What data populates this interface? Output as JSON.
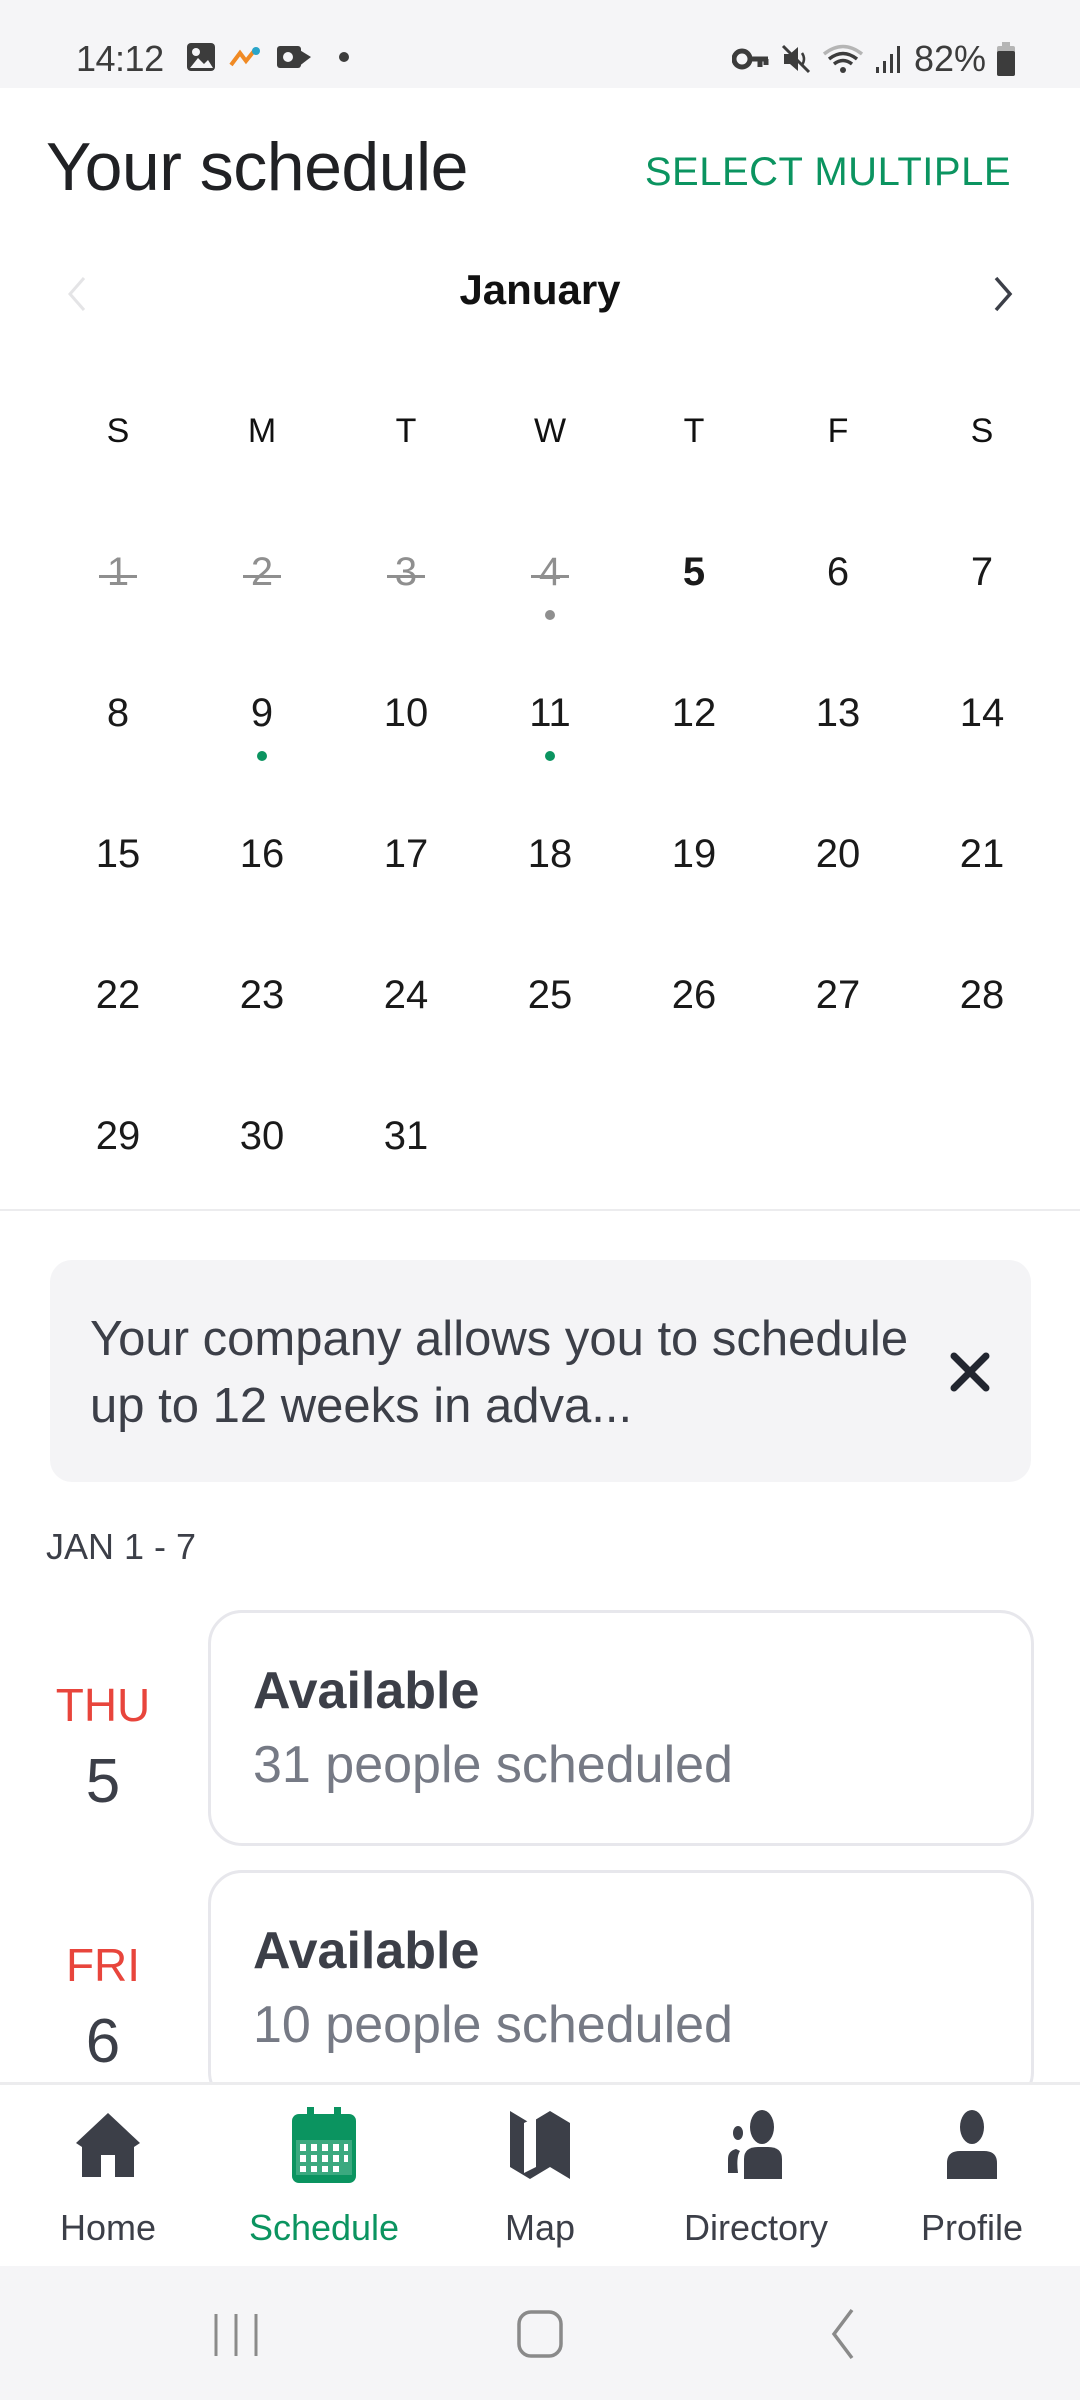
{
  "status_bar": {
    "time": "14:12",
    "battery": "82%",
    "left_icons": [
      "gallery-icon",
      "app-notification-icon",
      "outlook-icon",
      "more-dot-icon"
    ],
    "right_icons": [
      "vpn-key-icon",
      "mute-icon",
      "wifi-icon",
      "signal-icon",
      "battery-icon"
    ]
  },
  "header": {
    "title": "Your schedule",
    "select_multiple": "SELECT MULTIPLE"
  },
  "calendar": {
    "month": "January",
    "weekdays": [
      "S",
      "M",
      "T",
      "W",
      "T",
      "F",
      "S"
    ],
    "leading_blanks": 0,
    "days": [
      {
        "n": "1",
        "state": "past"
      },
      {
        "n": "2",
        "state": "past"
      },
      {
        "n": "3",
        "state": "past"
      },
      {
        "n": "4",
        "state": "past",
        "dot": "gray"
      },
      {
        "n": "5",
        "state": "today"
      },
      {
        "n": "6"
      },
      {
        "n": "7"
      },
      {
        "n": "8"
      },
      {
        "n": "9",
        "dot": "green"
      },
      {
        "n": "10"
      },
      {
        "n": "11",
        "dot": "green"
      },
      {
        "n": "12"
      },
      {
        "n": "13"
      },
      {
        "n": "14"
      },
      {
        "n": "15"
      },
      {
        "n": "16"
      },
      {
        "n": "17"
      },
      {
        "n": "18"
      },
      {
        "n": "19"
      },
      {
        "n": "20"
      },
      {
        "n": "21"
      },
      {
        "n": "22"
      },
      {
        "n": "23"
      },
      {
        "n": "24"
      },
      {
        "n": "25"
      },
      {
        "n": "26"
      },
      {
        "n": "27"
      },
      {
        "n": "28"
      },
      {
        "n": "29"
      },
      {
        "n": "30"
      },
      {
        "n": "31"
      }
    ],
    "dot_colors": {
      "green": "#0b9460",
      "gray": "#8f8f8f"
    }
  },
  "banner": {
    "text": "Your company allows you to schedule up to 12 weeks in adva..."
  },
  "week": {
    "label": "JAN 1 - 7",
    "rows": [
      {
        "weekday": "THU",
        "date": "5",
        "status": "Available",
        "people": "31 people scheduled"
      },
      {
        "weekday": "FRI",
        "date": "6",
        "status": "Available",
        "people": "10 people scheduled"
      }
    ]
  },
  "bottom_nav": {
    "tabs": [
      {
        "label": "Home",
        "icon": "home-icon"
      },
      {
        "label": "Schedule",
        "icon": "calendar-icon",
        "active": true
      },
      {
        "label": "Map",
        "icon": "map-icon"
      },
      {
        "label": "Directory",
        "icon": "directory-icon"
      },
      {
        "label": "Profile",
        "icon": "profile-icon"
      }
    ]
  },
  "colors": {
    "accent": "#0b9460",
    "weekday_red": "#e8453c",
    "icon_dark": "#3c3f48"
  }
}
